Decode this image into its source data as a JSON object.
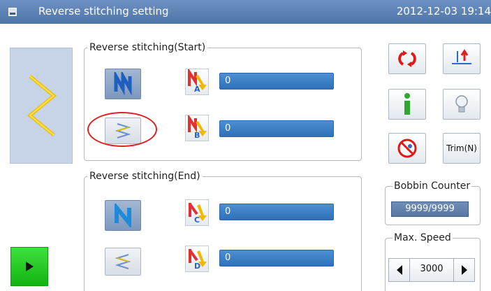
{
  "header": {
    "title": "Reverse stitching setting",
    "datetime": "2012-12-03 19:14"
  },
  "start_section": {
    "legend": "Reverse stitching(Start)",
    "param_a": {
      "letter": "A",
      "value": "0"
    },
    "param_b": {
      "letter": "B",
      "value": "0"
    }
  },
  "end_section": {
    "legend": "Reverse stitching(End)",
    "param_c": {
      "letter": "C",
      "value": "0"
    },
    "param_d": {
      "letter": "D",
      "value": "0"
    }
  },
  "right_panel": {
    "trim_label": "Trim(N)"
  },
  "bobbin_counter": {
    "label": "Bobbin Counter",
    "value": "9999/9999"
  },
  "max_speed": {
    "label": "Max. Speed",
    "value": "3000"
  },
  "colors": {
    "title_bar": "#5a7fb3",
    "field_blue": "#3a7cc3",
    "selected_button": "#8ea6c9",
    "play_green": "#22c322",
    "highlight_red": "#e02020",
    "stitch_yellow": "#f2c200"
  },
  "icons": {
    "title": "screen-icon",
    "play": "play-icon",
    "cycle": "cycle-icon",
    "needle": "needle-position-icon",
    "info": "info-icon",
    "bulb": "light-bulb-icon",
    "no_wiper": "no-wiper-icon"
  }
}
